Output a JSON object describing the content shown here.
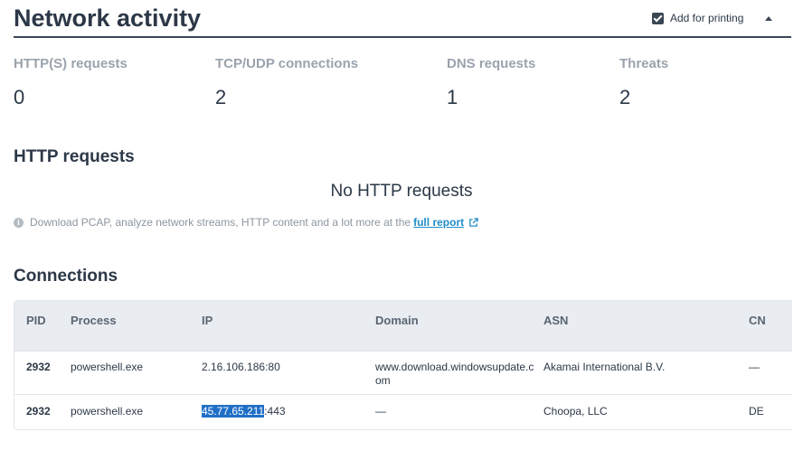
{
  "header": {
    "title": "Network activity",
    "print_label": "Add for printing",
    "print_checked": true
  },
  "stats": [
    {
      "label": "HTTP(S) requests",
      "value": "0"
    },
    {
      "label": "TCP/UDP connections",
      "value": "2"
    },
    {
      "label": "DNS requests",
      "value": "1"
    },
    {
      "label": "Threats",
      "value": "2"
    }
  ],
  "http": {
    "title": "HTTP requests",
    "empty_text": "No HTTP requests",
    "note_text": "Download PCAP, analyze network streams, HTTP content and a lot more at the",
    "note_link": "full report"
  },
  "connections": {
    "title": "Connections",
    "columns": [
      "PID",
      "Process",
      "IP",
      "Domain",
      "ASN",
      "CN"
    ],
    "rows": [
      {
        "pid": "2932",
        "process": "powershell.exe",
        "ip": "2.16.106.186:80",
        "ip_highlight": "",
        "ip_rest": "2.16.106.186:80",
        "domain": "www.download.windowsupdate.com",
        "asn": "Akamai International B.V.",
        "cn": "—"
      },
      {
        "pid": "2932",
        "process": "powershell.exe",
        "ip": "45.77.65.211:443",
        "ip_highlight": "45.77.65.211",
        "ip_rest": ":443",
        "domain": "—",
        "asn": "Choopa, LLC",
        "cn": "DE"
      }
    ]
  },
  "colors": {
    "accent_link": "#1f8dc7",
    "selection": "#1f6fc7",
    "table_header_bg": "#e9edf1"
  }
}
